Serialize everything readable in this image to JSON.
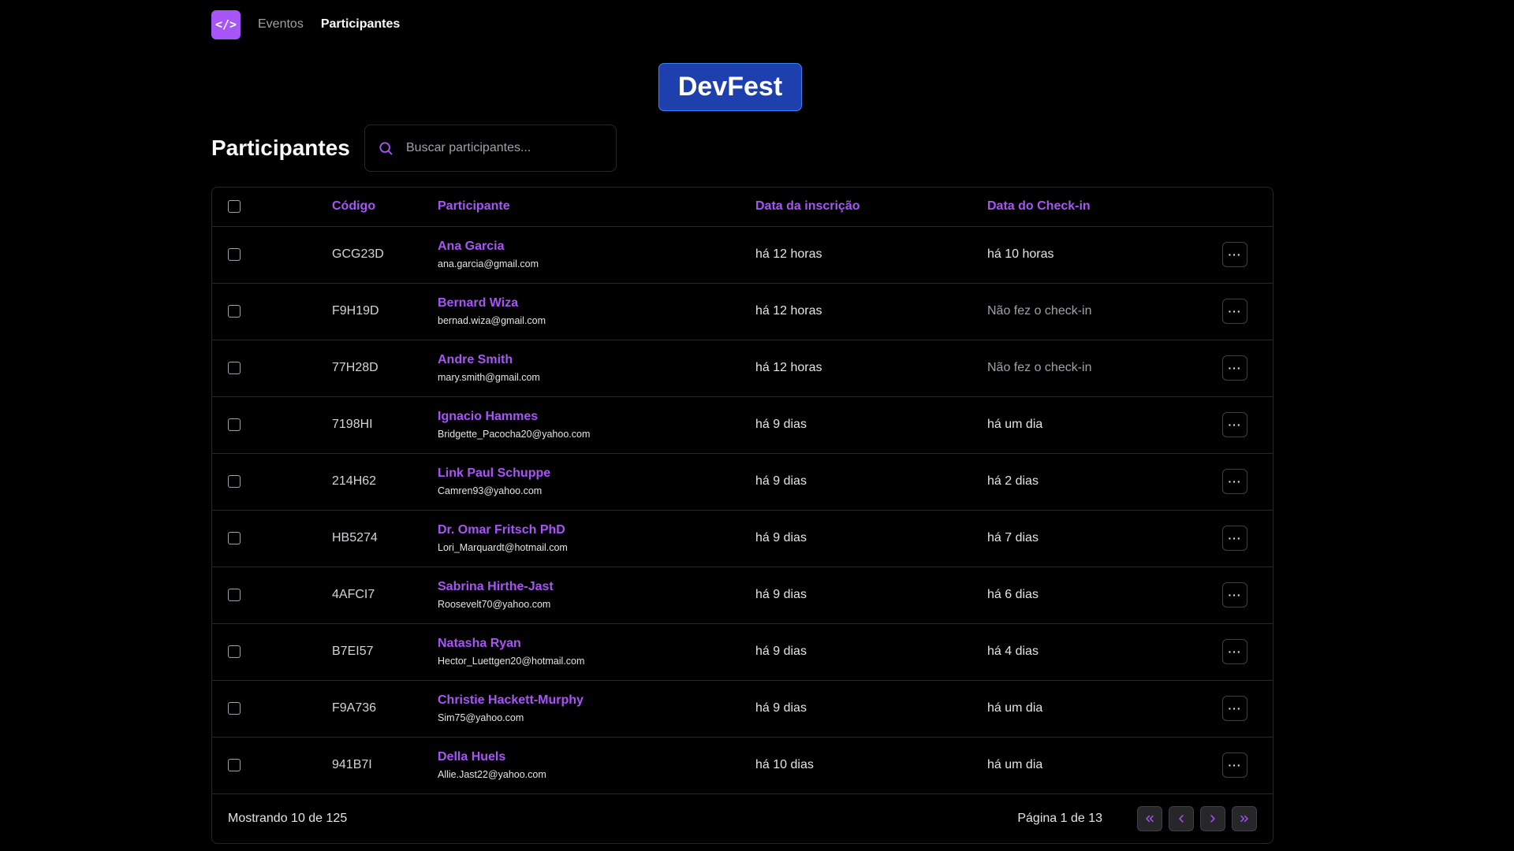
{
  "nav": {
    "logo_text": "</>",
    "links": [
      {
        "label": "Eventos",
        "active": false
      },
      {
        "label": "Participantes",
        "active": true
      }
    ]
  },
  "event": {
    "name": "DevFest"
  },
  "page": {
    "title": "Participantes"
  },
  "search": {
    "placeholder": "Buscar participantes...",
    "value": ""
  },
  "table": {
    "headers": {
      "code": "Código",
      "participant": "Participante",
      "registered": "Data da inscrição",
      "checkin": "Data do Check-in"
    },
    "rows": [
      {
        "code": "GCG23D",
        "name": "Ana Garcia",
        "email": "ana.garcia@gmail.com",
        "registered": "há 12 horas",
        "checkin": "há 10 horas",
        "checked_in": true
      },
      {
        "code": "F9H19D",
        "name": "Bernard Wiza",
        "email": "bernad.wiza@gmail.com",
        "registered": "há 12 horas",
        "checkin": "Não fez o check-in",
        "checked_in": false
      },
      {
        "code": "77H28D",
        "name": "Andre Smith",
        "email": "mary.smith@gmail.com",
        "registered": "há 12 horas",
        "checkin": "Não fez o check-in",
        "checked_in": false
      },
      {
        "code": "7198HI",
        "name": "Ignacio Hammes",
        "email": "Bridgette_Pacocha20@yahoo.com",
        "registered": "há 9 dias",
        "checkin": "há um dia",
        "checked_in": true
      },
      {
        "code": "214H62",
        "name": "Link Paul Schuppe",
        "email": "Camren93@yahoo.com",
        "registered": "há 9 dias",
        "checkin": "há 2 dias",
        "checked_in": true
      },
      {
        "code": "HB5274",
        "name": "Dr. Omar Fritsch PhD",
        "email": "Lori_Marquardt@hotmail.com",
        "registered": "há 9 dias",
        "checkin": "há 7 dias",
        "checked_in": true
      },
      {
        "code": "4AFCI7",
        "name": "Sabrina Hirthe-Jast",
        "email": "Roosevelt70@yahoo.com",
        "registered": "há 9 dias",
        "checkin": "há 6 dias",
        "checked_in": true
      },
      {
        "code": "B7EI57",
        "name": "Natasha Ryan",
        "email": "Hector_Luettgen20@hotmail.com",
        "registered": "há 9 dias",
        "checkin": "há 4 dias",
        "checked_in": true
      },
      {
        "code": "F9A736",
        "name": "Christie Hackett-Murphy",
        "email": "Sim75@yahoo.com",
        "registered": "há 9 dias",
        "checkin": "há um dia",
        "checked_in": true
      },
      {
        "code": "941B7I",
        "name": "Della Huels",
        "email": "Allie.Jast22@yahoo.com",
        "registered": "há 10 dias",
        "checkin": "há um dia",
        "checked_in": true
      }
    ],
    "row_action_icon": "more-horizontal-icon"
  },
  "footer": {
    "showing": "Mostrando 10 de 125",
    "page_info": "Página 1 de 13",
    "buttons": [
      "chevrons-left-icon",
      "chevron-left-icon",
      "chevron-right-icon",
      "chevrons-right-icon"
    ]
  },
  "colors": {
    "accent": "#a855f7",
    "banner": "#1e40af",
    "background": "#000000",
    "border": "#27272a"
  }
}
